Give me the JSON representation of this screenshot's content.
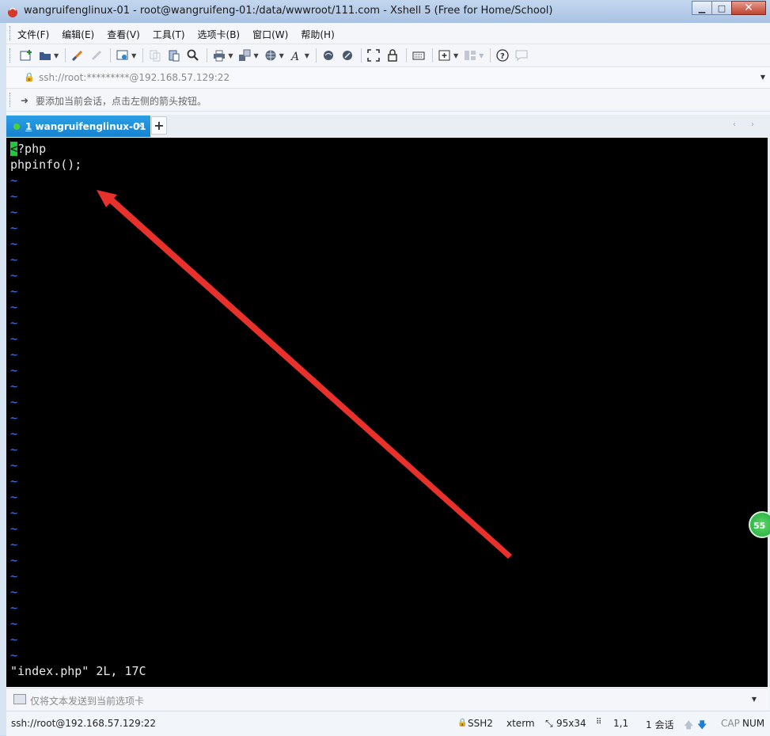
{
  "window": {
    "title": "wangruifenglinux-01 - root@wangruifeng-01:/data/wwwroot/111.com - Xshell 5 (Free for Home/School)",
    "minimize": "▁",
    "maximize": "□",
    "close": "✕"
  },
  "menu": {
    "items": [
      "文件(F)",
      "编辑(E)",
      "查看(V)",
      "工具(T)",
      "选项卡(B)",
      "窗口(W)",
      "帮助(H)"
    ]
  },
  "toolbar": {
    "icons": [
      "new-session-icon",
      "open-folder-icon",
      "reconnect-icon",
      "disconnect-icon",
      "properties-icon",
      "copy-icon",
      "paste-icon",
      "find-icon",
      "print-icon",
      "transfer-icon",
      "globe-icon",
      "font-icon",
      "xftp-icon",
      "xmanager-icon",
      "fullscreen-icon",
      "lock-icon",
      "keyboard-icon",
      "add-icon",
      "layout-icon",
      "help-icon",
      "chat-icon"
    ]
  },
  "address": {
    "value": "ssh://root:*********@192.168.57.129:22"
  },
  "hint": {
    "text": "要添加当前会话，点击左侧的箭头按钮。"
  },
  "tabs": [
    {
      "number": "1",
      "label": " wangruifenglinux-01",
      "close": "×",
      "status_color": "#4cd137"
    }
  ],
  "tab_add": "+",
  "tab_nav": "‹ ›",
  "terminal": {
    "cursor_char": "<",
    "line1_rest": "?php",
    "line2": "phpinfo();",
    "tilde": "~",
    "tilde_count": 31,
    "status_line": "\"index.php\" 2L, 17C",
    "colors": {
      "background": "#000000",
      "text": "#e8e8e8",
      "tilde": "#3d7cf0",
      "cursor": "#1ec93b",
      "annotation_arrow": "#e8312a"
    }
  },
  "sendbar": {
    "text": "仅将文本发送到当前选项卡"
  },
  "status": {
    "connection": "ssh://root@192.168.57.129:22",
    "protocol": "SSH2",
    "terminal_type": "xterm",
    "size": "95x34",
    "position": "1,1",
    "sessions": "1 会话",
    "cap": "CAP",
    "num": "NUM"
  },
  "badge": {
    "text": "55"
  }
}
